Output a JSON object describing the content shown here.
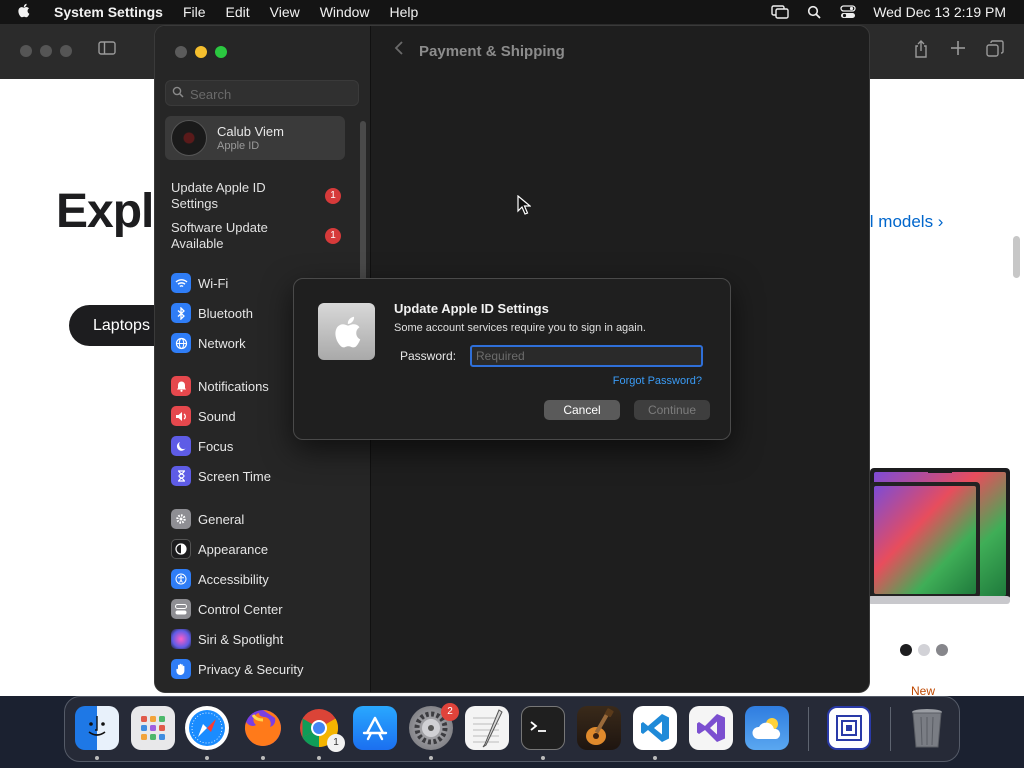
{
  "menubar": {
    "app_name": "System Settings",
    "menus": [
      "File",
      "Edit",
      "View",
      "Window",
      "Help"
    ],
    "clock": "Wed Dec 13  2:19 PM"
  },
  "browser": {
    "hero_text": "Exple",
    "pill_text": "Laptops",
    "models_link": "ll models ›",
    "new_label": "New"
  },
  "settings": {
    "page_title": "Payment & Shipping",
    "search_placeholder": "Search",
    "account": {
      "name": "Calub Viem",
      "subtitle": "Apple ID"
    },
    "notices": [
      {
        "label": "Update Apple ID Settings",
        "badge": "1"
      },
      {
        "label": "Software Update Available",
        "badge": "1"
      }
    ],
    "items": [
      {
        "label": "Wi-Fi",
        "icon": "wifi-icon",
        "color": "#2f7df6"
      },
      {
        "label": "Bluetooth",
        "icon": "bluetooth-icon",
        "color": "#2f7df6"
      },
      {
        "label": "Network",
        "icon": "globe-icon",
        "color": "#2f7df6"
      },
      {
        "label": "Notifications",
        "icon": "bell-icon",
        "color": "#e5484d"
      },
      {
        "label": "Sound",
        "icon": "speaker-icon",
        "color": "#e5484d"
      },
      {
        "label": "Focus",
        "icon": "moon-icon",
        "color": "#5e5ce6"
      },
      {
        "label": "Screen Time",
        "icon": "hourglass-icon",
        "color": "#5e5ce6"
      },
      {
        "label": "General",
        "icon": "gear-icon",
        "color": "#8e8e93"
      },
      {
        "label": "Appearance",
        "icon": "appearance-icon",
        "color": "#1c1c1e"
      },
      {
        "label": "Accessibility",
        "icon": "accessibility-icon",
        "color": "#2f7df6"
      },
      {
        "label": "Control Center",
        "icon": "control-center-icon",
        "color": "#8e8e93"
      },
      {
        "label": "Siri & Spotlight",
        "icon": "siri-icon",
        "color": "#bf5af2"
      },
      {
        "label": "Privacy & Security",
        "icon": "hand-icon",
        "color": "#2f7df6"
      }
    ]
  },
  "dialog": {
    "title": "Update Apple ID Settings",
    "message": "Some account services require you to sign in again.",
    "password_label": "Password:",
    "password_placeholder": "Required",
    "forgot_link": "Forgot Password?",
    "cancel_label": "Cancel",
    "continue_label": "Continue"
  },
  "dock": {
    "apps": [
      {
        "name": "finder",
        "color": "#2d8cf0"
      },
      {
        "name": "launchpad",
        "color": "#e8e8ea"
      },
      {
        "name": "safari",
        "color": "#1a8cff"
      },
      {
        "name": "firefox",
        "color": "#ff7a1a"
      },
      {
        "name": "chrome",
        "color": "#ffffff",
        "badge": "1"
      },
      {
        "name": "app-store",
        "color": "#1e88f7"
      },
      {
        "name": "system-settings",
        "color": "#8a8a8e",
        "badge": "2"
      },
      {
        "name": "textedit",
        "color": "#f4f4f4"
      },
      {
        "name": "terminal",
        "color": "#1f1f1f"
      },
      {
        "name": "garageband",
        "color": "#6b4a2b"
      },
      {
        "name": "vscode",
        "color": "#ffffff"
      },
      {
        "name": "visual-studio",
        "color": "#f5f5f5"
      },
      {
        "name": "weather",
        "color": "#3f8de0"
      },
      {
        "name": "screen-sharing",
        "color": "#ffffff"
      },
      {
        "name": "trash",
        "color": "#7a7d84"
      }
    ]
  }
}
